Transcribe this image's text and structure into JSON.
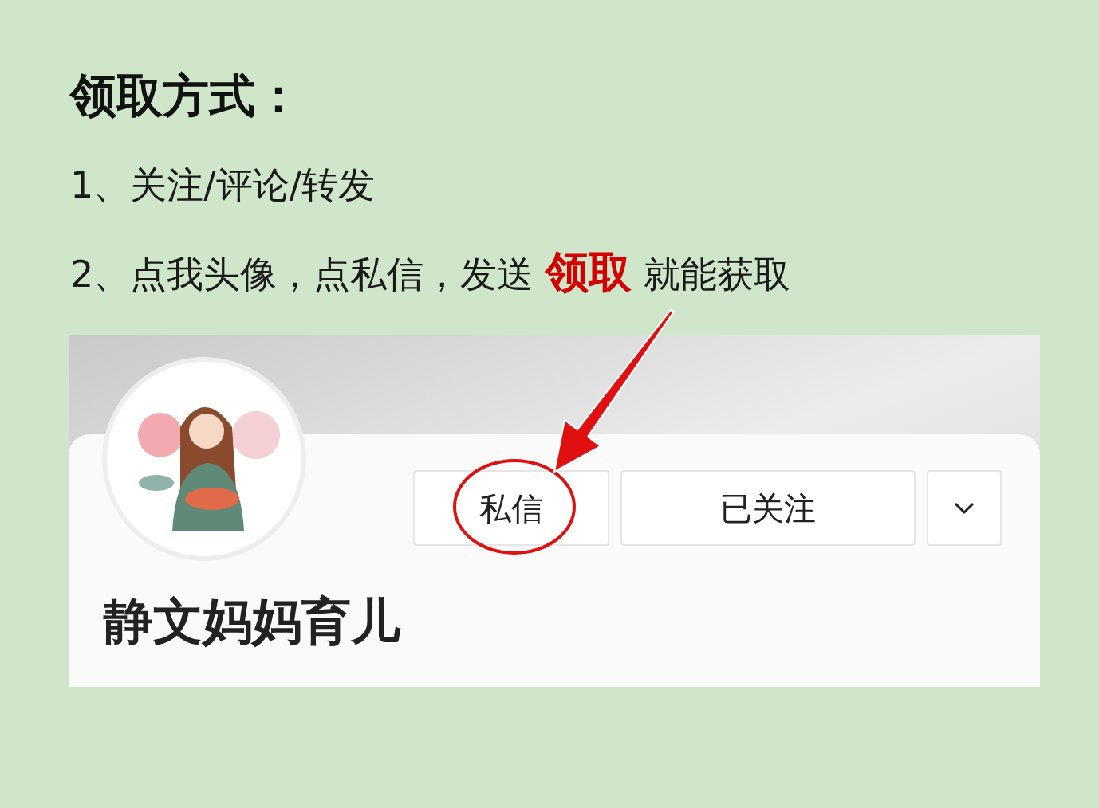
{
  "title": "领取方式：",
  "steps": [
    "1、关注/评论/转发",
    "2、点我头像，点私信，发送 **领取** 就能获取"
  ],
  "profile": {
    "name": "静文妈妈育儿",
    "buttons": [
      {
        "kind": "text",
        "label": "私信",
        "highlighted": true
      },
      {
        "kind": "text",
        "label": "已关注",
        "highlighted": false
      },
      {
        "kind": "dropdown"
      }
    ]
  }
}
